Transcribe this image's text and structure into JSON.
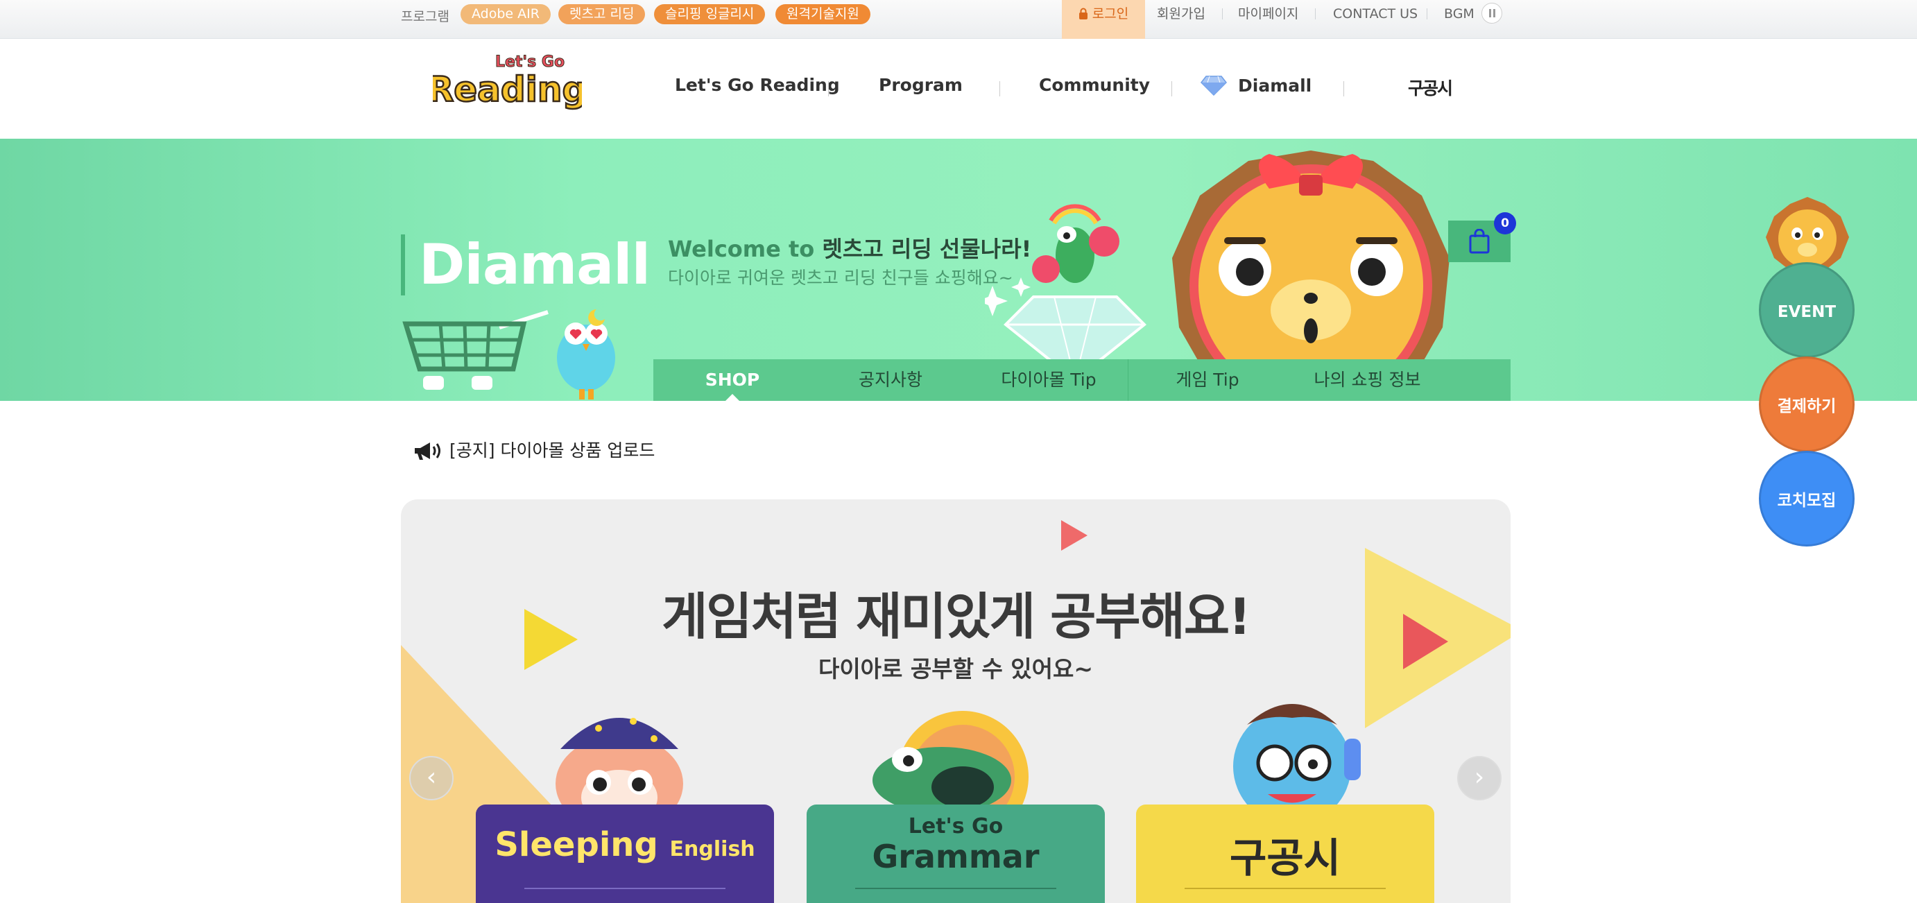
{
  "topbar": {
    "program_label": "프로그램",
    "pills": [
      {
        "label": "Adobe AIR",
        "color": "#f2b978"
      },
      {
        "label": "렛츠고 리딩",
        "color": "#f2a25a"
      },
      {
        "label": "슬리핑 잉글리시",
        "color": "#ef8f3a"
      },
      {
        "label": "원격기술지원",
        "color": "#f08a34"
      }
    ],
    "login": "로그인",
    "signup": "회원가입",
    "mypage": "마이페이지",
    "contact": "CONTACT US",
    "bgm": "BGM"
  },
  "header": {
    "logo_small": "Let's Go",
    "logo_big": "Reading",
    "nav": [
      "Let's Go Reading",
      "Program",
      "Community",
      "Diamall"
    ],
    "kgs": "구공시"
  },
  "banner": {
    "title": "Diamall",
    "welcome_prefix": "Welcome to",
    "welcome_strong": "렛츠고 리딩 선물나라!",
    "welcome_sub": "다이아로 귀여운 렛츠고 리딩 친구들 쇼핑해요~",
    "tabs": [
      "SHOP",
      "공지사항",
      "다이아몰 Tip",
      "게임 Tip",
      "나의 쇼핑 정보"
    ],
    "cart_count": "0"
  },
  "notice": {
    "text": "[공지] 다이아몰 상품 업로드"
  },
  "hero": {
    "headline": "게임처럼 재미있게 공부해요!",
    "subline": "다이아로 공부할 수 있어요~",
    "tickets": [
      {
        "title": "Sleeping",
        "title2": "English",
        "color": "#4a3591",
        "text_color": "#ffe56a"
      },
      {
        "title": "Let's Go",
        "title2": "Grammar",
        "color": "#47a986",
        "text_color": "#1f3b31"
      },
      {
        "title": "구공시",
        "title2": "",
        "color": "#f5d94a",
        "text_color": "#2a2a2a"
      }
    ]
  },
  "float_buttons": [
    {
      "label": "EVENT",
      "color": "#4fb091"
    },
    {
      "label": "결제하기",
      "color": "#ee7b3a"
    },
    {
      "label": "코치모집",
      "color": "#3e8ef5"
    }
  ]
}
